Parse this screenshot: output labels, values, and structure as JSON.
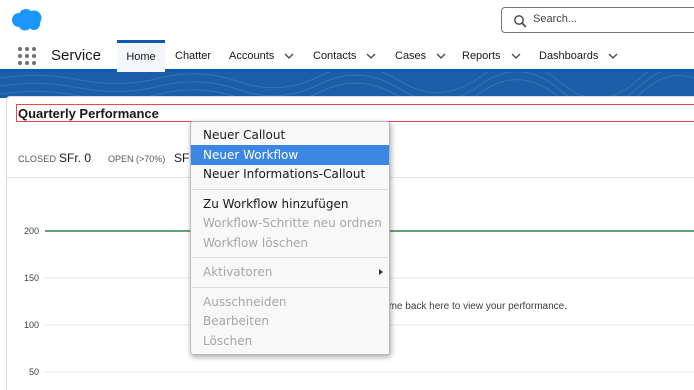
{
  "header": {
    "search_placeholder": "Search...",
    "icons": {
      "logo": "salesforce-cloud-logo",
      "search": "search-icon"
    },
    "colors": {
      "brand": "#1b96ff",
      "nav_accent": "#0a5ab3"
    }
  },
  "nav": {
    "app_name": "Service",
    "items": [
      {
        "label": "Home",
        "active": true,
        "has_menu": false
      },
      {
        "label": "Chatter",
        "active": false,
        "has_menu": false
      },
      {
        "label": "Accounts",
        "active": false,
        "has_menu": true
      },
      {
        "label": "Contacts",
        "active": false,
        "has_menu": true
      },
      {
        "label": "Cases",
        "active": false,
        "has_menu": true
      },
      {
        "label": "Reports",
        "active": false,
        "has_menu": true
      },
      {
        "label": "Dashboards",
        "active": false,
        "has_menu": true
      }
    ]
  },
  "card": {
    "title": "Quarterly Performance",
    "closed_label": "CLOSED",
    "closed_value": "SFr. 0",
    "open_label": "OPEN (>70%)",
    "open_value": "SFr",
    "message": "ing on, then come back here to view your performance."
  },
  "chart_data": {
    "type": "line",
    "y_ticks": [
      "200",
      "150",
      "100",
      "50"
    ],
    "goal_line_value": 200,
    "goal_line_color": "#2e844a"
  },
  "context_menu": {
    "items": [
      {
        "label": "Neuer Callout",
        "state": "enabled"
      },
      {
        "label": "Neuer Workflow",
        "state": "selected"
      },
      {
        "label": "Neuer Informations-Callout",
        "state": "enabled"
      },
      {
        "label": "Zu Workflow hinzufügen",
        "state": "enabled"
      },
      {
        "label": "Workflow-Schritte neu ordnen",
        "state": "disabled"
      },
      {
        "label": "Workflow löschen",
        "state": "disabled"
      },
      {
        "label": "Aktivatoren",
        "state": "disabled",
        "submenu": true
      },
      {
        "label": "Ausschneiden",
        "state": "disabled"
      },
      {
        "label": "Bearbeiten",
        "state": "disabled"
      },
      {
        "label": "Löschen",
        "state": "disabled"
      }
    ]
  }
}
